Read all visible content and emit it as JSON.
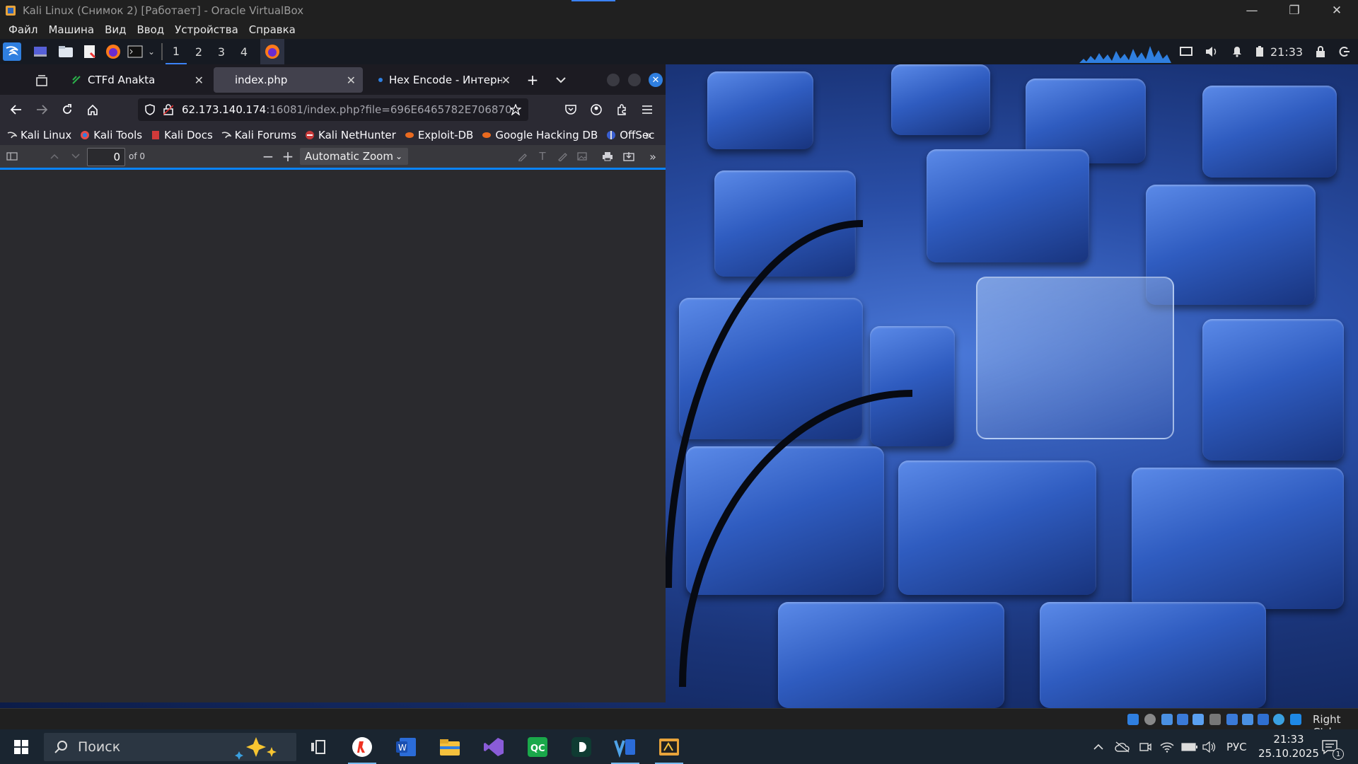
{
  "vbox": {
    "title": "Kali Linux  (Снимок 2) [Работает] - Oracle VirtualBox",
    "menu": [
      "Файл",
      "Машина",
      "Вид",
      "Ввод",
      "Устройства",
      "Справка"
    ],
    "status_right": "Right Ctrl"
  },
  "kali_panel": {
    "workspaces": [
      "1",
      "2",
      "3",
      "4"
    ],
    "active_workspace": "1",
    "time": "21:33"
  },
  "firefox": {
    "tabs": [
      {
        "label": "CTFd Anakta",
        "selected": false
      },
      {
        "label": "index.php",
        "selected": true
      },
      {
        "label": "Hex Encode - Интернет",
        "selected": false
      }
    ],
    "url_host": "62.173.140.174",
    "url_rest": ":16081/index.php?file=696E6465782E706870",
    "bookmarks": [
      "Kali Linux",
      "Kali Tools",
      "Kali Docs",
      "Kali Forums",
      "Kali NetHunter",
      "Exploit-DB",
      "Google Hacking DB",
      "OffSec"
    ],
    "pdf": {
      "page_value": "0",
      "page_total": "of 0",
      "zoom": "Automatic Zoom"
    }
  },
  "taskbar": {
    "search_placeholder": "Поиск",
    "lang": "РУС",
    "time": "21:33",
    "date": "25.10.2025",
    "notifications": "1"
  },
  "colors": {
    "accent": "#0a84ff",
    "firefox_bg": "#1c1b22",
    "pdf_view": "#2a2a2e",
    "taskbar": "#1a2530"
  }
}
